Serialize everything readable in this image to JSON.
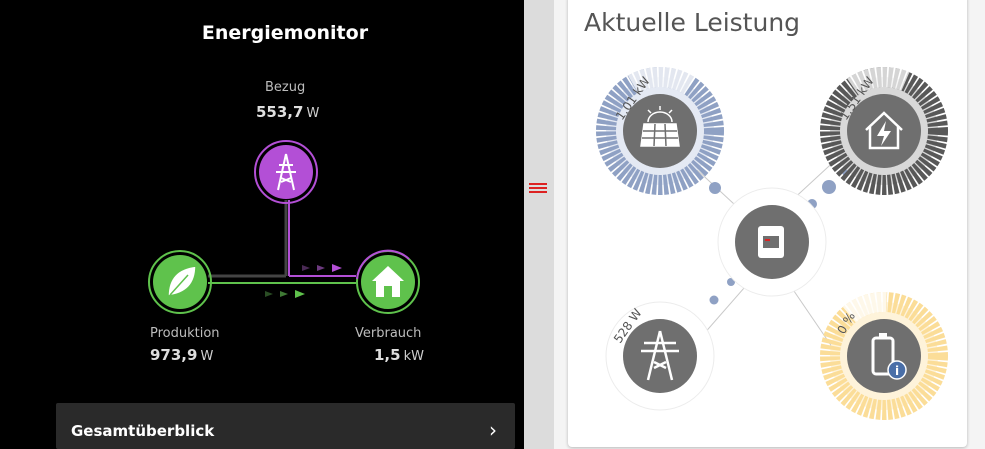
{
  "energy_monitor": {
    "title": "Energiemonitor",
    "grid": {
      "label": "Bezug",
      "value": "553,7",
      "unit": "W"
    },
    "production": {
      "label": "Produktion",
      "value": "973,9",
      "unit": "W"
    },
    "consumption": {
      "label": "Verbrauch",
      "value": "1,5",
      "unit": "kW"
    },
    "overview_button": {
      "label": "Gesamtüberblick"
    },
    "colors": {
      "grid": "#b34fd6",
      "production": "#5fc24c",
      "consumption": "#5fc24c"
    }
  },
  "current_power": {
    "title": "Aktuelle Leistung",
    "pv": {
      "value": "1.01 kW",
      "icon": "solar-panel-icon"
    },
    "house": {
      "value": "1.51 kW",
      "icon": "house-lightning-icon"
    },
    "grid": {
      "value": "528 W",
      "icon": "power-pylon-icon"
    },
    "battery": {
      "value": "0 %",
      "icon": "battery-icon"
    },
    "inverter": {
      "icon": "inverter-icon"
    },
    "colors": {
      "pv": "#8fa1c4",
      "house": "#585858",
      "battery": "#fbdd98"
    }
  }
}
